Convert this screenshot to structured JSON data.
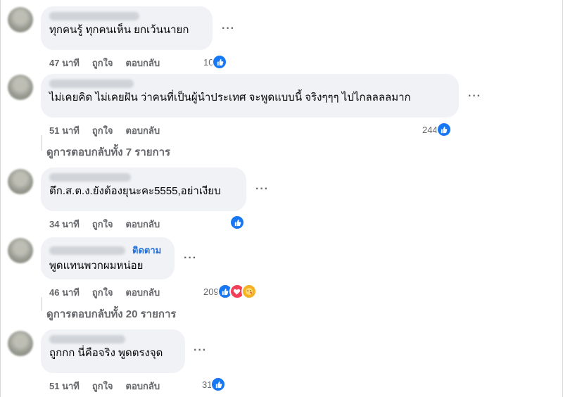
{
  "comments": [
    {
      "text": "ทุกคนรู้ ทุกคนเห็น ยกเว้นนายก",
      "time": "47 นาที",
      "like_label": "ถูกใจ",
      "reply_label": "ตอบกลับ",
      "reaction_count": "10",
      "reactions": [
        "like-icon"
      ]
    },
    {
      "text": "ไม่เคยคิด ไม่เคยฝัน ว่าคนที่เป็นผู้นำประเทศ จะพูดแบบนี้ จริงๆๆๆ ไปไกลลลลมาก",
      "time": "51 นาที",
      "like_label": "ถูกใจ",
      "reply_label": "ตอบกลับ",
      "reaction_count": "244",
      "reactions": [
        "like-icon"
      ],
      "view_replies": "ดูการตอบกลับทั้ง 7 รายการ"
    },
    {
      "text": "ตึก.ส.ต.ง.ยังต้องยุนะคะ5555,อย่าเงียบ",
      "time": "34 นาที",
      "like_label": "ถูกใจ",
      "reply_label": "ตอบกลับ",
      "reaction_count": "",
      "reactions": [
        "like-icon"
      ]
    },
    {
      "follow_label": "ติดตาม",
      "text": "พูดแทนพวกผมหน่อย",
      "time": "46 นาที",
      "like_label": "ถูกใจ",
      "reply_label": "ตอบกลับ",
      "reaction_count": "209",
      "reactions": [
        "like-icon",
        "love-icon",
        "care-icon"
      ],
      "view_replies": "ดูการตอบกลับทั้ง 20 รายการ"
    },
    {
      "text": "ถูกกก นี่คือจริง พูดตรงจุด",
      "time": "51 นาที",
      "like_label": "ถูกใจ",
      "reply_label": "ตอบกลับ",
      "reaction_count": "31",
      "reactions": [
        "like-icon"
      ]
    }
  ],
  "more_label": "···",
  "colors": {
    "bubble": "#f0f2f5",
    "secondary_text": "#65676b",
    "like": "#1877f2",
    "follow": "#216fdb"
  }
}
